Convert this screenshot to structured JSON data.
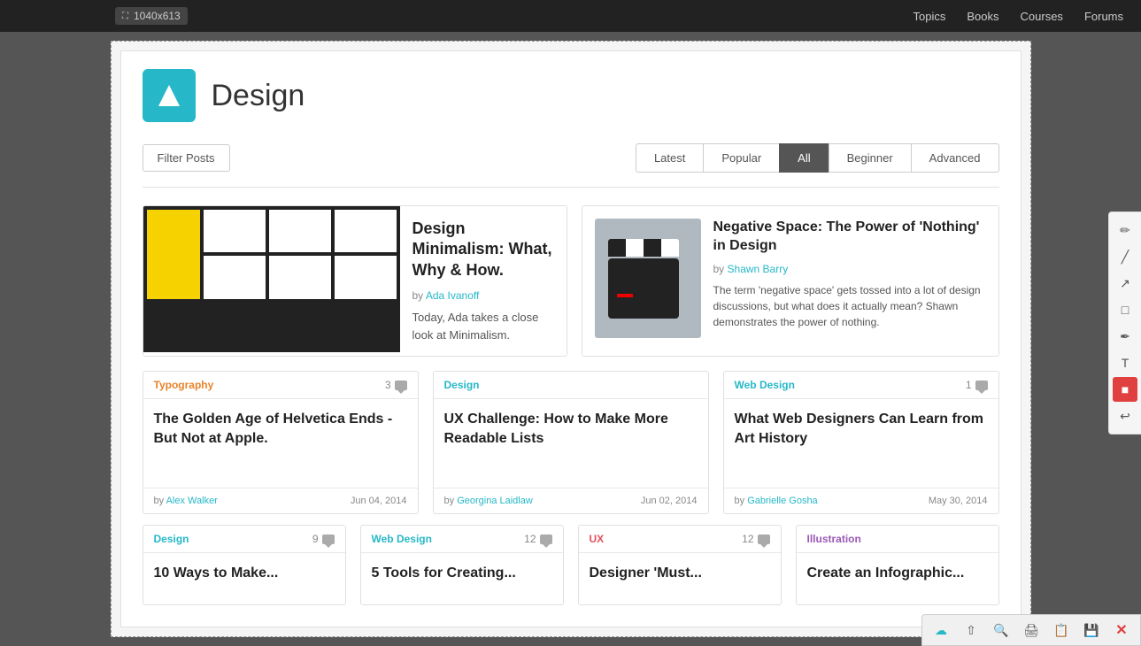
{
  "topNav": {
    "dimension": "1040x613",
    "links": [
      "Topics",
      "Books",
      "Courses",
      "Forums"
    ]
  },
  "header": {
    "title": "Design",
    "logoAlt": "design-logo"
  },
  "filterBar": {
    "filterButtonLabel": "Filter Posts",
    "tabs": [
      {
        "label": "Latest",
        "active": false
      },
      {
        "label": "Popular",
        "active": false
      },
      {
        "label": "All",
        "active": true
      },
      {
        "label": "Beginner",
        "active": false
      },
      {
        "label": "Advanced",
        "active": false
      }
    ]
  },
  "featuredLarge": {
    "title": "Design Minimalism: What, Why & How.",
    "authorPrefix": "by",
    "author": "Ada Ivanoff",
    "excerpt": "Today, Ada takes a close look at Minimalism."
  },
  "featuredSmall": {
    "title": "Negative Space: The Power of 'Nothing' in Design",
    "authorPrefix": "by",
    "author": "Shawn Barry",
    "excerpt": "The term 'negative space' gets tossed into a lot of design discussions, but what does it actually mean? Shawn demonstrates the power of nothing."
  },
  "cards": [
    {
      "category": "Typography",
      "categoryClass": "cat-typography",
      "commentCount": "3",
      "title": "The Golden Age of Helvetica Ends - But Not at Apple.",
      "author": "Alex Walker",
      "date": "Jun 04, 2014"
    },
    {
      "category": "Design",
      "categoryClass": "cat-design",
      "commentCount": "",
      "title": "UX Challenge: How to Make More Readable Lists",
      "author": "Georgina Laidlaw",
      "date": "Jun 02, 2014"
    },
    {
      "category": "Web Design",
      "categoryClass": "cat-webdesign",
      "commentCount": "1",
      "title": "What Web Designers Can Learn from Art History",
      "author": "Gabrielle Gosha",
      "date": "May 30, 2014"
    }
  ],
  "cards2": [
    {
      "category": "Design",
      "categoryClass": "cat-design",
      "commentCount": "9",
      "title": "10 Ways to Make...",
      "author": "",
      "date": ""
    },
    {
      "category": "Web Design",
      "categoryClass": "cat-webdesign",
      "commentCount": "12",
      "title": "5 Tools for Creating...",
      "author": "",
      "date": ""
    },
    {
      "category": "UX",
      "categoryClass": "cat-ux",
      "commentCount": "12",
      "title": "Designer 'Must...",
      "author": "",
      "date": ""
    },
    {
      "category": "Illustration",
      "categoryClass": "cat-illustration",
      "commentCount": "",
      "title": "Create an Infographic...",
      "author": "",
      "date": ""
    }
  ],
  "toolbar": {
    "buttons": [
      "✏️",
      "—",
      "↗",
      "□",
      "✏",
      "T",
      "■",
      "↩"
    ]
  },
  "bottomBar": {
    "buttons": [
      "☁",
      "⇧",
      "🔍",
      "🖨",
      "📋",
      "💾",
      "✕"
    ]
  }
}
